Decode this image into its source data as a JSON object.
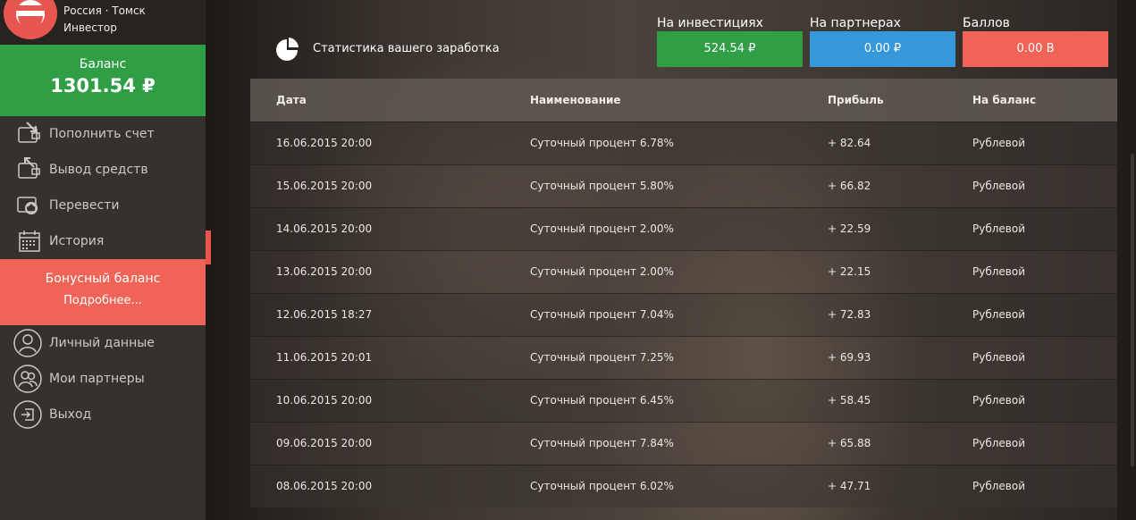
{
  "profile": {
    "location": "Россия · Томск",
    "role": "Инвестор"
  },
  "balance": {
    "label": "Баланс",
    "amount": "1301.54 ₽"
  },
  "menu": [
    {
      "label": "Пополнить счет",
      "icon": "wallet-in-icon"
    },
    {
      "label": "Вывод средств",
      "icon": "wallet-out-icon"
    },
    {
      "label": "Перевести",
      "icon": "transfer-icon"
    },
    {
      "label": "История",
      "icon": "calendar-icon"
    }
  ],
  "bonus": {
    "title": "Бонусный баланс",
    "link": "Подробнее..."
  },
  "menu2": [
    {
      "label": "Личный данные",
      "icon": "user-icon"
    },
    {
      "label": "Мои партнеры",
      "icon": "partners-icon"
    },
    {
      "label": "Выход",
      "icon": "logout-icon"
    }
  ],
  "stats": {
    "title": "Статистика вашего заработка",
    "boxes": [
      {
        "caption": "На инвестициях",
        "value": "524.54 ₽",
        "color": "#2f9e44"
      },
      {
        "caption": "На партнерах",
        "value": "0.00 ₽",
        "color": "#3498db"
      },
      {
        "caption": "Баллов",
        "value": "0.00 B",
        "color": "#f06458"
      }
    ]
  },
  "table": {
    "headers": [
      "Дата",
      "Наименование",
      "Прибыль",
      "На баланс"
    ],
    "rows": [
      [
        "16.06.2015 20:00",
        "Суточный процент 6.78%",
        "+ 82.64",
        "Рублевой"
      ],
      [
        "15.06.2015 20:00",
        "Суточный процент 5.80%",
        "+ 66.82",
        "Рублевой"
      ],
      [
        "14.06.2015 20:00",
        "Суточный процент 2.00%",
        "+ 22.59",
        "Рублевой"
      ],
      [
        "13.06.2015 20:00",
        "Суточный процент 2.00%",
        "+ 22.15",
        "Рублевой"
      ],
      [
        "12.06.2015 18:27",
        "Суточный процент 7.04%",
        "+ 72.83",
        "Рублевой"
      ],
      [
        "11.06.2015 20:01",
        "Суточный процент 7.25%",
        "+ 69.93",
        "Рублевой"
      ],
      [
        "10.06.2015 20:00",
        "Суточный процент 6.45%",
        "+ 58.45",
        "Рублевой"
      ],
      [
        "09.06.2015 20:00",
        "Суточный процент 7.84%",
        "+ 65.88",
        "Рублевой"
      ],
      [
        "08.06.2015 20:00",
        "Суточный процент 6.02%",
        "+ 47.71",
        "Рублевой"
      ]
    ]
  }
}
